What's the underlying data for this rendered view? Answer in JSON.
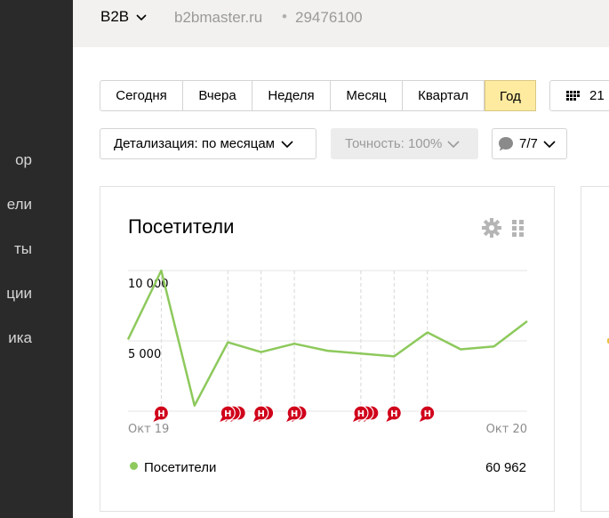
{
  "sidebar": {
    "items": [
      {
        "label": "Обзор",
        "visible_text": "ор"
      },
      {
        "label": "Посетители",
        "visible_text": "ели"
      },
      {
        "label": "Отчеты",
        "visible_text": "ты"
      },
      {
        "label": "Конверсии",
        "visible_text": "ции"
      },
      {
        "label": "Аналитика",
        "visible_text": "ика"
      }
    ]
  },
  "header": {
    "counter_name": "B2B",
    "domain": "b2bmaster.ru",
    "separator": "•",
    "counter_id": "29476100"
  },
  "period": {
    "options": [
      "Сегодня",
      "Вчера",
      "Неделя",
      "Месяц",
      "Квартал",
      "Год"
    ],
    "active": "Год"
  },
  "calendar": {
    "label": "21",
    "icon": "calendar-grid-icon"
  },
  "filters": {
    "detail_label": "Детализация: по месяцам",
    "accuracy_label": "Точность: 100%",
    "notes_label": "7/7"
  },
  "widget": {
    "title": "Посетители",
    "legend_label": "Посетители",
    "legend_value": "60 962",
    "line_color": "#8dc95c"
  },
  "chart_data": {
    "type": "line",
    "title": "Посетители",
    "x_start_label": "Окт 19",
    "x_end_label": "Окт 20",
    "y_ticks": [
      "10 000",
      "5 000"
    ],
    "y_tick_values": [
      10000,
      5000
    ],
    "ylim": [
      0,
      10000
    ],
    "grid": true,
    "series": [
      {
        "name": "Посетители",
        "color": "#8dc95c",
        "values": [
          5100,
          10000,
          400,
          4900,
          4200,
          4800,
          4300,
          4100,
          3900,
          5600,
          4400,
          4600,
          6400
        ]
      }
    ],
    "annotation_marker_label": "Н",
    "annotation_marker_color": "#d0021b",
    "annotation_groups": [
      {
        "point": 1,
        "count": 1
      },
      {
        "point": 3,
        "count": 3
      },
      {
        "point": 4,
        "count": 2
      },
      {
        "point": 5,
        "count": 2
      },
      {
        "point": 7,
        "count": 3
      },
      {
        "point": 8,
        "count": 1
      },
      {
        "point": 9,
        "count": 1
      }
    ]
  }
}
